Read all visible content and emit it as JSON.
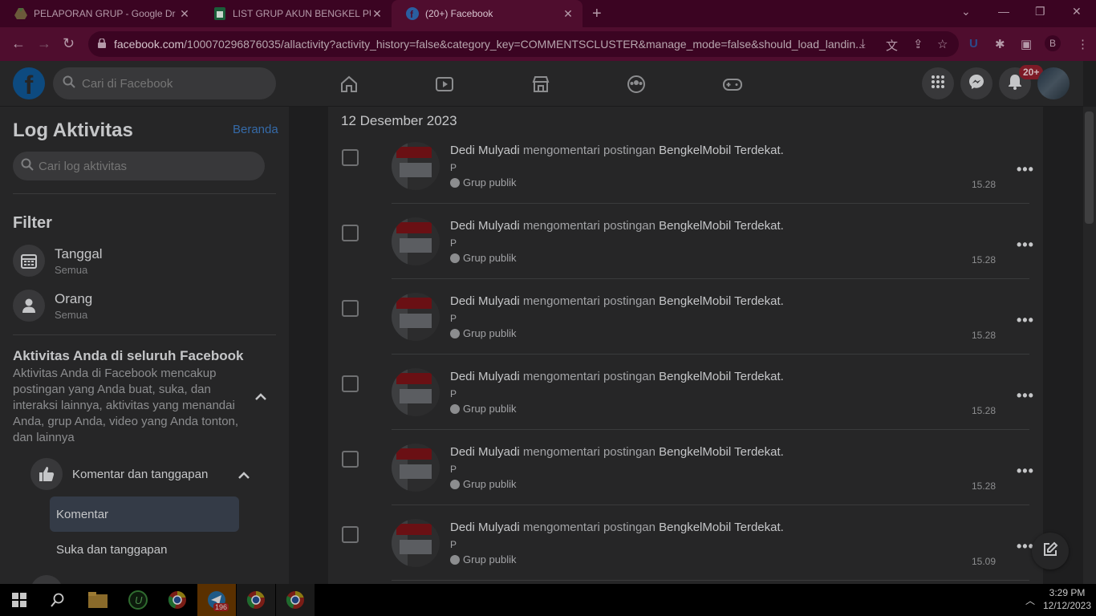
{
  "browser": {
    "tabs": [
      {
        "title": "PELAPORAN GRUP - Google Dr",
        "icon": "google-drive-icon",
        "active": false
      },
      {
        "title": "LIST GRUP AKUN BENGKEL PUR",
        "icon": "google-sheets-icon",
        "active": false
      },
      {
        "title": "(20+) Facebook",
        "icon": "facebook-icon",
        "active": true
      }
    ],
    "url_host": "facebook.com",
    "url_path": "/100070296876035/allactivity?activity_history=false&category_key=COMMENTSCLUSTER&manage_mode=false&should_load_landin...",
    "profile_initial": "B"
  },
  "fb_header": {
    "search_placeholder": "Cari di Facebook",
    "notif_badge": "20+"
  },
  "sidebar": {
    "title": "Log Aktivitas",
    "home_link": "Beranda",
    "search_placeholder": "Cari log aktivitas",
    "filter_title": "Filter",
    "filters": [
      {
        "name": "Tanggal",
        "sub": "Semua"
      },
      {
        "name": "Orang",
        "sub": "Semua"
      }
    ],
    "section_title": "Aktivitas Anda di seluruh Facebook",
    "section_desc": "Aktivitas Anda di Facebook mencakup postingan yang Anda buat, suka, dan interaksi lainnya, aktivitas yang menandai Anda, grup Anda, video yang Anda tonton, dan lainnya",
    "category": "Komentar dan tanggapan",
    "subitems": [
      "Komentar",
      "Suka dan tanggapan"
    ]
  },
  "main": {
    "date_heading": "12 Desember 2023",
    "items": [
      {
        "actor": "Dedi Mulyadi",
        "verb": "mengomentari postingan",
        "target": "BengkelMobil Terdekat",
        "comment": "P",
        "audience": "Grup publik",
        "time": "15.28"
      },
      {
        "actor": "Dedi Mulyadi",
        "verb": "mengomentari postingan",
        "target": "BengkelMobil Terdekat",
        "comment": "P",
        "audience": "Grup publik",
        "time": "15.28"
      },
      {
        "actor": "Dedi Mulyadi",
        "verb": "mengomentari postingan",
        "target": "BengkelMobil Terdekat",
        "comment": "P",
        "audience": "Grup publik",
        "time": "15.28"
      },
      {
        "actor": "Dedi Mulyadi",
        "verb": "mengomentari postingan",
        "target": "BengkelMobil Terdekat",
        "comment": "P",
        "audience": "Grup publik",
        "time": "15.28"
      },
      {
        "actor": "Dedi Mulyadi",
        "verb": "mengomentari postingan",
        "target": "BengkelMobil Terdekat",
        "comment": "P",
        "audience": "Grup publik",
        "time": "15.28"
      },
      {
        "actor": "Dedi Mulyadi",
        "verb": "mengomentari postingan",
        "target": "BengkelMobil Terdekat",
        "comment": "P",
        "audience": "Grup publik",
        "time": "15.09"
      }
    ]
  },
  "taskbar": {
    "telegram_badge": "196",
    "time": "3:29 PM",
    "date": "12/12/2023"
  }
}
